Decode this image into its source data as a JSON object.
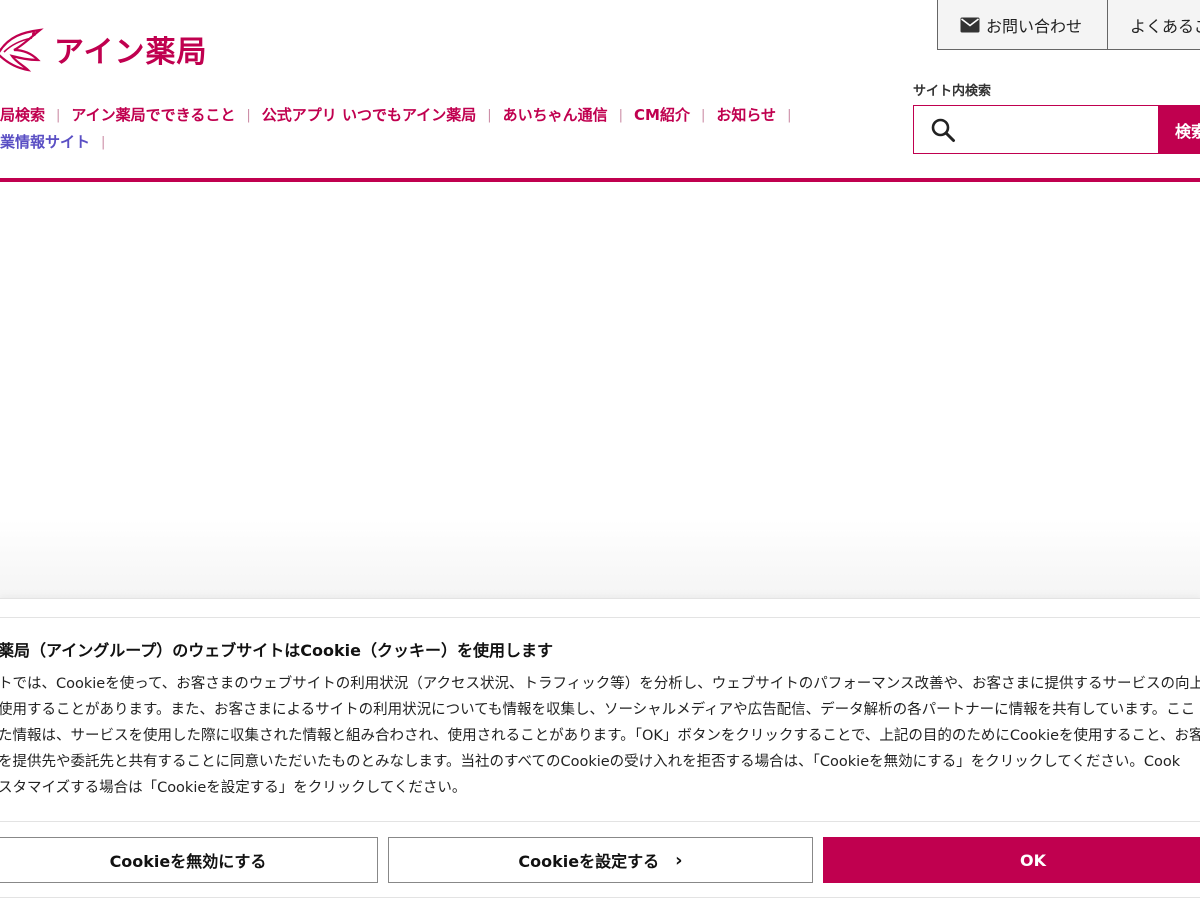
{
  "header": {
    "logo_text": "アイン薬局",
    "top_buttons": {
      "contact_label": "お問い合わせ",
      "faq_label": "よくあるご"
    },
    "nav_row1": [
      "局検索",
      "アイン薬局でできること",
      "公式アプリ いつでもアイン薬局",
      "あいちゃん通信",
      "CM紹介",
      "お知らせ"
    ],
    "nav_row2": [
      "業情報サイト"
    ],
    "search": {
      "label": "サイト内検索",
      "placeholder": "",
      "button_label": "検索"
    }
  },
  "cookie": {
    "title": "薬局（アイングループ）のウェブサイトはCookie（クッキー）を使用します",
    "body_lines": [
      "トでは、Cookieを使って、お客さまのウェブサイトの利用状況（アクセス状況、トラフィック等）を分析し、ウェブサイトのパフォーマンス改善や、お客さまに提供するサービスの向上、ご",
      "使用することがあります。また、お客さまによるサイトの利用状況についても情報を収集し、ソーシャルメディアや広告配信、データ解析の各パートナーに情報を共有しています。ここ",
      "た情報は、サービスを使用した際に収集された情報と組み合わされ、使用されることがあります。「OK」ボタンをクリックすることで、上記の目的のためにCookieを使用すること、お客",
      "を提供先や委託先と共有することに同意いただいたものとみなします。当社のすべてのCookieの受け入れを拒否する場合は、「Cookieを無効にする」をクリックしてください。Cook",
      "スタマイズする場合は「Cookieを設定する」をクリックしてください。"
    ],
    "buttons": {
      "disable_label": "Cookieを無効にする",
      "settings_label": "Cookieを設定する",
      "ok_label": "OK"
    }
  },
  "colors": {
    "brand": "#c0004f",
    "nav_blue": "#5a4fc4"
  },
  "icons": {
    "logo": "bird-logo-icon",
    "mail": "mail-icon",
    "search": "search-icon",
    "chevron": "chevron-right-icon"
  }
}
